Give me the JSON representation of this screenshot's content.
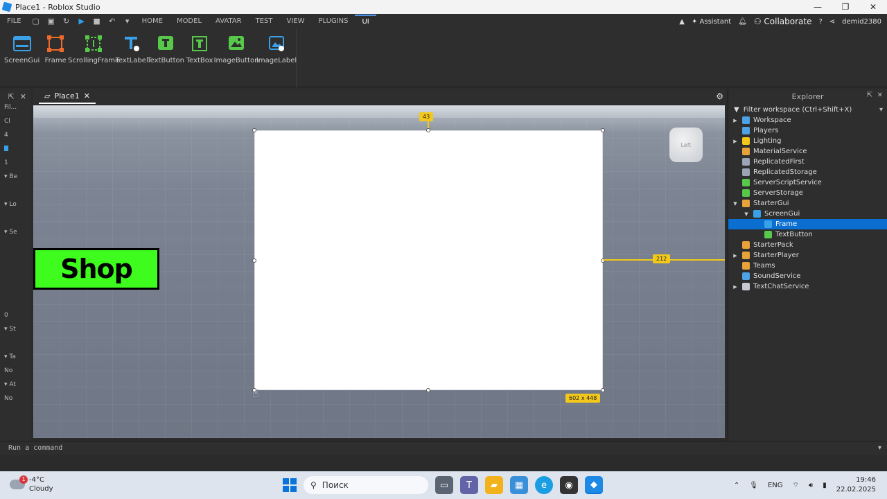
{
  "window": {
    "title": "Place1 - Roblox Studio",
    "minimize": "—",
    "maximize": "❐",
    "close": "✕"
  },
  "menubar": {
    "file": "FILE",
    "tabs": [
      "HOME",
      "MODEL",
      "AVATAR",
      "TEST",
      "VIEW",
      "PLUGINS",
      "UI"
    ],
    "active_tab": "UI",
    "assistant": "Assistant",
    "collaborate": "Collaborate",
    "user": "demid2380"
  },
  "ribbon": {
    "tools": [
      {
        "label": "ScreenGui",
        "icon": "screengui-icon",
        "color": "#3aa0e8"
      },
      {
        "label": "Frame",
        "icon": "frame-icon",
        "color": "#f06a2a"
      },
      {
        "label": "ScrollingFrame",
        "icon": "scrollingframe-icon",
        "color": "#58c84a"
      },
      {
        "label": "TextLabel",
        "icon": "textlabel-icon",
        "color": "#3aa0e8"
      },
      {
        "label": "TextButton",
        "icon": "textbutton-icon",
        "color": "#58c84a"
      },
      {
        "label": "TextBox",
        "icon": "textbox-icon",
        "color": "#58c84a"
      },
      {
        "label": "ImageButton",
        "icon": "imagebutton-icon",
        "color": "#58c84a"
      },
      {
        "label": "ImageLabel",
        "icon": "imagelabel-icon",
        "color": "#3aa0e8"
      }
    ]
  },
  "left_panel": {
    "filter": "Fil...",
    "rows": [
      "Cl",
      "4",
      "",
      "1",
      "Be",
      "",
      "Lo",
      "",
      "Se",
      "",
      "",
      "",
      "",
      "",
      "0",
      "St",
      "",
      "Ta",
      "No",
      "At",
      "No"
    ]
  },
  "doc_tab": {
    "label": "Place1"
  },
  "viewport": {
    "shop_button_text": "Shop",
    "top_offset_badge": "43",
    "right_offset_badge": "212",
    "size_badge": "602 x 448",
    "view_cube_label": "Left"
  },
  "explorer": {
    "title": "Explorer",
    "filter": "Filter workspace (Ctrl+Shift+X)",
    "items": [
      {
        "label": "Workspace",
        "depth": 0,
        "arrow": "▶",
        "color": "#4da3e6"
      },
      {
        "label": "Players",
        "depth": 0,
        "arrow": "",
        "color": "#4da3e6"
      },
      {
        "label": "Lighting",
        "depth": 0,
        "arrow": "▶",
        "color": "#f2c81b"
      },
      {
        "label": "MaterialService",
        "depth": 0,
        "arrow": "",
        "color": "#e8a23a"
      },
      {
        "label": "ReplicatedFirst",
        "depth": 0,
        "arrow": "",
        "color": "#9aa4b3"
      },
      {
        "label": "ReplicatedStorage",
        "depth": 0,
        "arrow": "",
        "color": "#9aa4b3"
      },
      {
        "label": "ServerScriptService",
        "depth": 0,
        "arrow": "",
        "color": "#58c84a"
      },
      {
        "label": "ServerStorage",
        "depth": 0,
        "arrow": "",
        "color": "#58c84a"
      },
      {
        "label": "StarterGui",
        "depth": 0,
        "arrow": "▼",
        "color": "#e8a23a"
      },
      {
        "label": "ScreenGui",
        "depth": 1,
        "arrow": "▼",
        "color": "#3aa0e8"
      },
      {
        "label": "Frame",
        "depth": 2,
        "arrow": "",
        "color": "#3aa0e8",
        "selected": true
      },
      {
        "label": "TextButton",
        "depth": 2,
        "arrow": "",
        "color": "#58c84a"
      },
      {
        "label": "StarterPack",
        "depth": 0,
        "arrow": "",
        "color": "#e8a23a"
      },
      {
        "label": "StarterPlayer",
        "depth": 0,
        "arrow": "▶",
        "color": "#e8a23a"
      },
      {
        "label": "Teams",
        "depth": 0,
        "arrow": "",
        "color": "#e8a23a"
      },
      {
        "label": "SoundService",
        "depth": 0,
        "arrow": "",
        "color": "#4da3e6"
      },
      {
        "label": "TextChatService",
        "depth": 0,
        "arrow": "▶",
        "color": "#c8ccd2"
      }
    ]
  },
  "command_bar": {
    "placeholder": "Run a command"
  },
  "taskbar": {
    "weather_temp": "-4°C",
    "weather_desc": "Cloudy",
    "weather_badge": "1",
    "search": "Поиск",
    "lang": "ENG",
    "time": "19:46",
    "date": "22.02.2025"
  }
}
